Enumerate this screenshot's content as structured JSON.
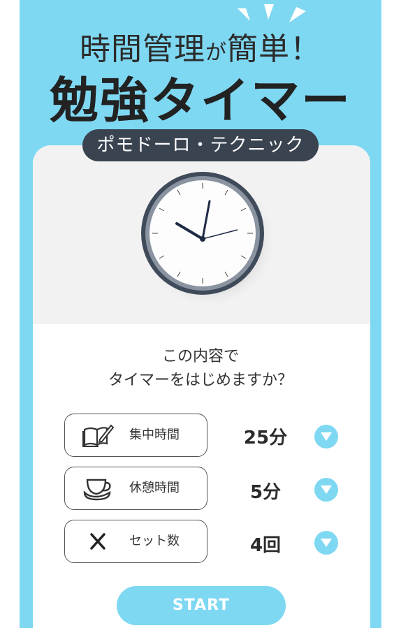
{
  "header": {
    "title_part1": "時間管理",
    "title_connector": "が",
    "title_part2": "簡単！",
    "main_title": "勉強タイマー"
  },
  "badge": {
    "label": "ポモドーロ・テクニック"
  },
  "question": {
    "line1": "この内容で",
    "line2": "タイマーをはじめますか？"
  },
  "settings": [
    {
      "label": "集中時間",
      "value": "25分",
      "icon": "book-pencil-icon"
    },
    {
      "label": "休憩時間",
      "value": "5分",
      "icon": "coffee-cup-icon"
    },
    {
      "label": "セット数",
      "value": "4回",
      "icon": "times-icon"
    }
  ],
  "start_button": {
    "label": "START"
  },
  "colors": {
    "accent": "#7fd8f2",
    "badge": "#3a4350",
    "text": "#2b2b2b"
  }
}
